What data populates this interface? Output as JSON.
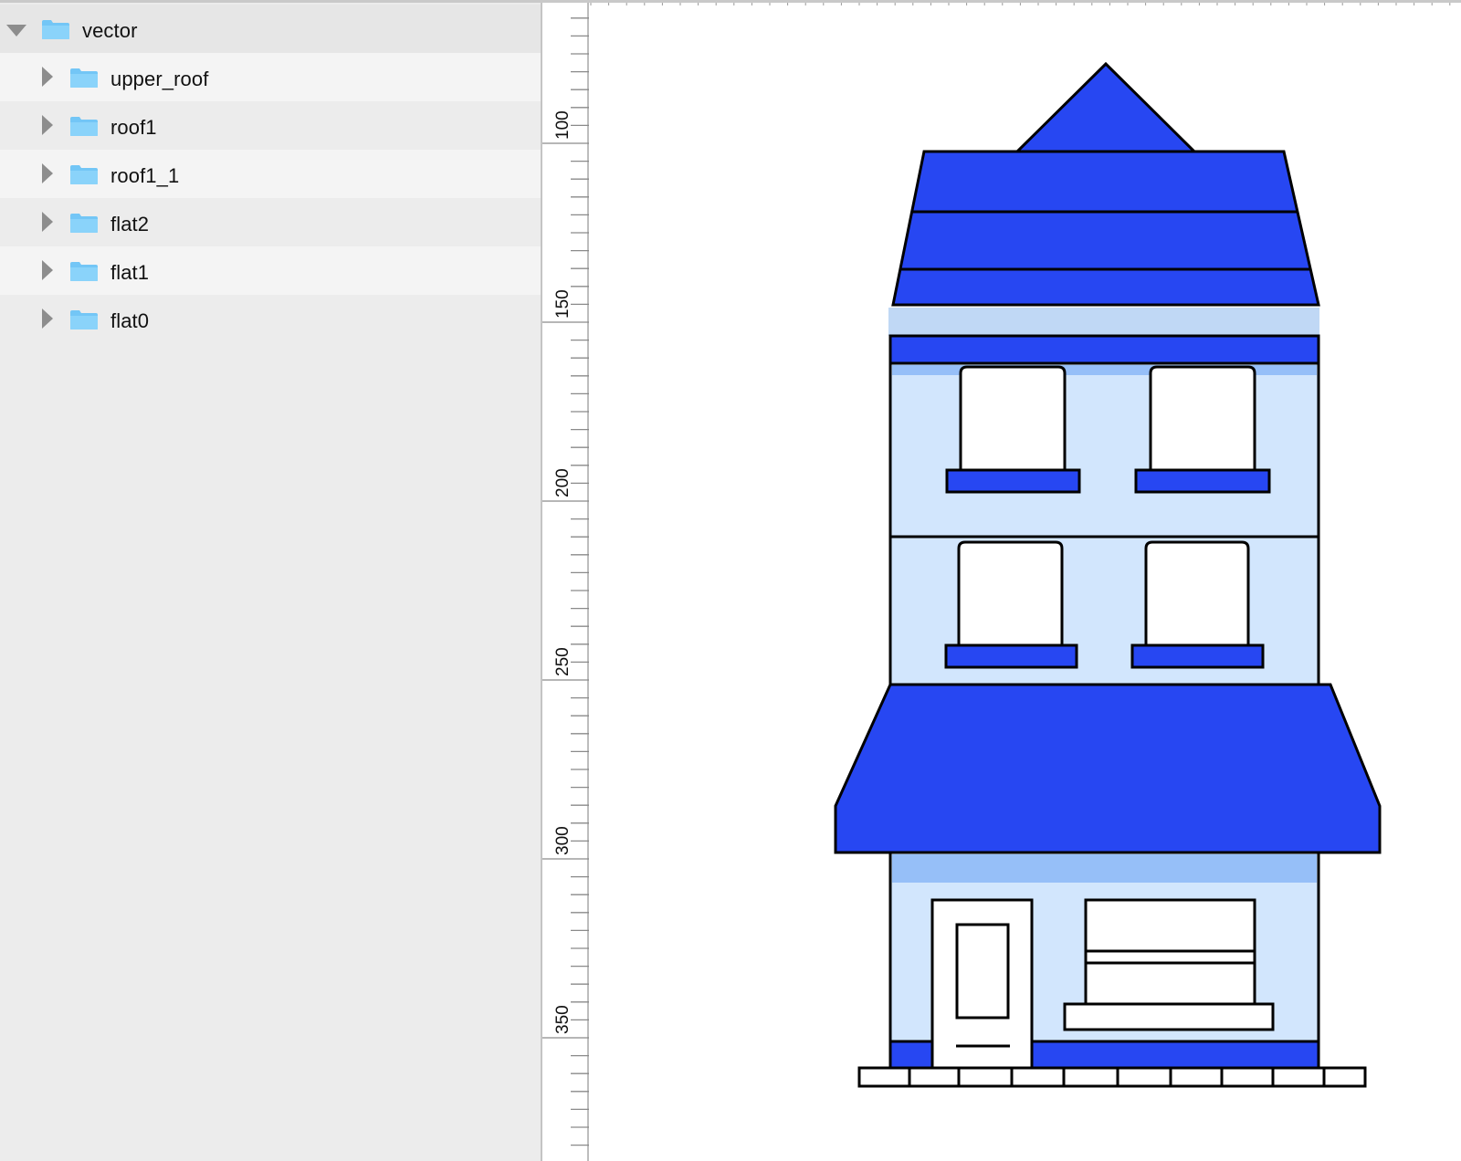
{
  "layers": {
    "root": {
      "label": "vector",
      "icon": "folder-icon",
      "expanded": true
    },
    "children": [
      {
        "label": "upper_roof",
        "icon": "folder-icon",
        "expanded": false
      },
      {
        "label": "roof1",
        "icon": "folder-icon",
        "expanded": false
      },
      {
        "label": "roof1_1",
        "icon": "folder-icon",
        "expanded": false
      },
      {
        "label": "flat2",
        "icon": "folder-icon",
        "expanded": false
      },
      {
        "label": "flat1",
        "icon": "folder-icon",
        "expanded": false
      },
      {
        "label": "flat0",
        "icon": "folder-icon",
        "expanded": false
      }
    ]
  },
  "ruler": {
    "labels": [
      "100",
      "150",
      "200",
      "250",
      "300",
      "350"
    ]
  },
  "colors": {
    "accent_blue": "#2747f2",
    "wall_light": "#d2e6fd",
    "trim_light": "#c0d8f5",
    "band_mid": "#96bff8",
    "folder": "#73c6f6",
    "panel_bg": "#ececec"
  }
}
